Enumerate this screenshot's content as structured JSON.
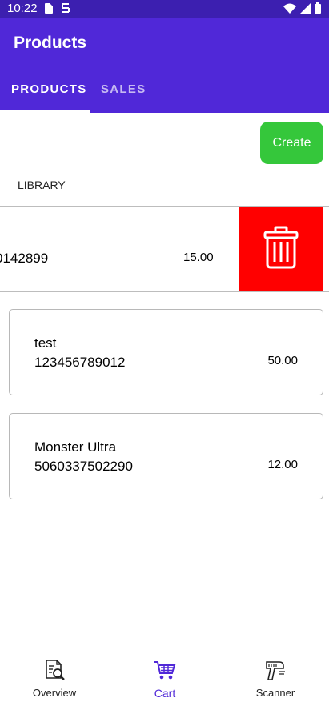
{
  "status_bar": {
    "time": "10:22"
  },
  "header": {
    "title": "Products",
    "tabs": [
      {
        "label": "PRODUCTS",
        "active": true
      },
      {
        "label": "SALES",
        "active": false
      }
    ]
  },
  "actions": {
    "create_label": "Create"
  },
  "section": {
    "library_label": "LIBRARY"
  },
  "swiped_item": {
    "barcode": "0142899",
    "price": "15.00"
  },
  "products": [
    {
      "name": "test",
      "barcode": "123456789012",
      "price": "50.00"
    },
    {
      "name": "Monster Ultra",
      "barcode": "5060337502290",
      "price": "12.00"
    }
  ],
  "bottom_nav": {
    "items": [
      {
        "label": "Overview",
        "icon": "document-search-icon"
      },
      {
        "label": "Cart",
        "icon": "cart-icon"
      },
      {
        "label": "Scanner",
        "icon": "barcode-scanner-icon"
      }
    ]
  },
  "colors": {
    "primary": "#5028d8",
    "status_bar": "#3c1fb0",
    "create": "#35c73b",
    "delete": "#ff0000"
  }
}
